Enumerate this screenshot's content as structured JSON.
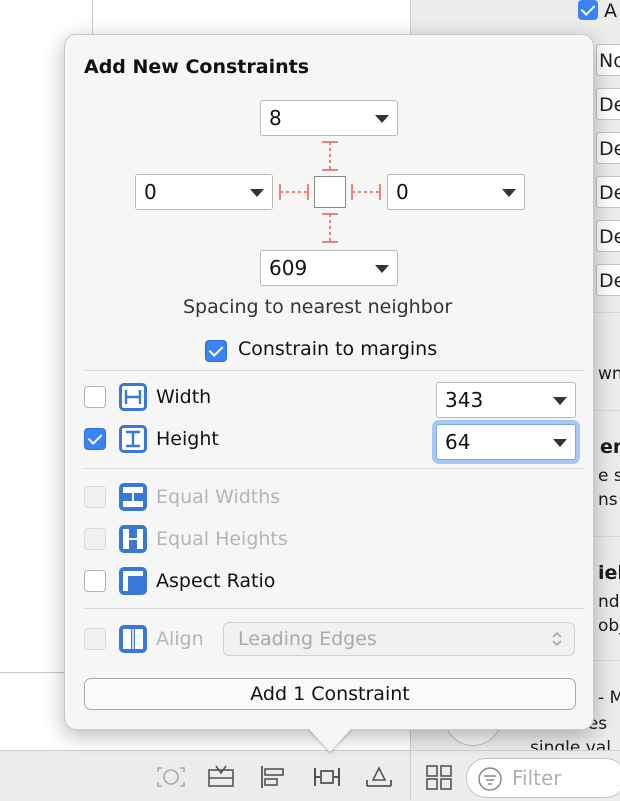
{
  "popover": {
    "title": "Add New Constraints",
    "spacing": {
      "top": "8",
      "left": "0",
      "right": "0",
      "bottom": "609",
      "hint": "Spacing to nearest neighbor"
    },
    "constrain_to_margins": {
      "label": "Constrain to margins",
      "checked": true
    },
    "width": {
      "label": "Width",
      "value": "343",
      "checked": false
    },
    "height": {
      "label": "Height",
      "value": "64",
      "checked": true
    },
    "equal_widths": {
      "label": "Equal Widths",
      "enabled": false
    },
    "equal_heights": {
      "label": "Equal Heights",
      "enabled": false
    },
    "aspect_ratio": {
      "label": "Aspect Ratio",
      "checked": false
    },
    "align": {
      "label": "Align",
      "selected": "Leading Edges",
      "enabled": false
    },
    "add_button": "Add 1 Constraint"
  },
  "inspector": {
    "row_top": "A",
    "fields": [
      "No",
      "De",
      "De",
      "De",
      "De",
      "De"
    ],
    "text1": "wn",
    "heading2": "en",
    "text2a": "e s",
    "text2b": "ns",
    "heading3": "iel",
    "text3a": "nds",
    "text3b": "obj",
    "text4": "- M",
    "text4b": "of values",
    "text4c": "single val"
  },
  "bottom_bar": {
    "filter_placeholder": "Filter"
  },
  "colors": {
    "accent": "#3b82f6",
    "guide": "#e8837a"
  }
}
